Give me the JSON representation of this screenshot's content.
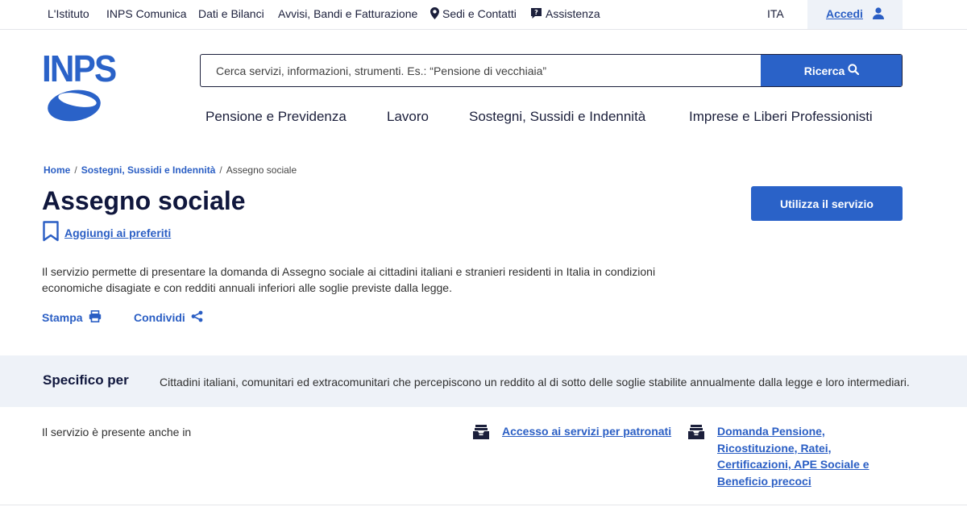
{
  "topbar": {
    "links": [
      {
        "label": "L'Istituto"
      },
      {
        "label": "INPS Comunica"
      },
      {
        "label": "Dati e Bilanci"
      },
      {
        "label": "Avvisi, Bandi e Fatturazione"
      },
      {
        "label": "Sedi e Contatti",
        "icon": "map-pin-icon"
      },
      {
        "label": "Assistenza",
        "icon": "chat-question-icon"
      }
    ],
    "language": "ITA",
    "login_label": "Accedi"
  },
  "logo": {
    "text": "INPS"
  },
  "search": {
    "placeholder": "Cerca servizi, informazioni, strumenti. Es.: “Pensione di vecchiaia”",
    "value": "",
    "button_label": "Ricerca"
  },
  "main_nav": [
    {
      "label": "Pensione e Previdenza"
    },
    {
      "label": "Lavoro"
    },
    {
      "label": "Sostegni, Sussidi e Indennità"
    },
    {
      "label": "Imprese e Liberi Professionisti"
    }
  ],
  "breadcrumb": {
    "items": [
      {
        "label": "Home"
      },
      {
        "label": "Sostegni, Sussidi e Indennità"
      }
    ],
    "separator": "/",
    "current": "Assegno sociale"
  },
  "page": {
    "title": "Assegno sociale",
    "favorite_label": "Aggiungi ai preferiti",
    "cta_label": "Utilizza il servizio",
    "description": "Il servizio permette di presentare la domanda di Assegno sociale ai cittadini italiani e stranieri residenti in Italia in condizioni economiche disagiate e con redditi annuali inferiori alle soglie previste dalla legge.",
    "print_label": "Stampa",
    "share_label": "Condividi"
  },
  "specific": {
    "label": "Specifico per",
    "value": "Cittadini italiani, comunitari ed extracomunitari che percepiscono un reddito al di sotto delle soglie stabilite annualmente dalla legge e loro intermediari."
  },
  "also_in": {
    "label": "Il servizio è presente anche in",
    "items": [
      {
        "label": "Accesso ai servizi per patronati",
        "icon": "inbox-tray-icon"
      },
      {
        "label": "Domanda Pensione, Ricostituzione, Ratei, Certificazioni, APE Sociale e Beneficio precoci",
        "icon": "inbox-tray-icon"
      }
    ]
  },
  "colors": {
    "accent": "#2a62c8",
    "link": "#2a5ec4",
    "title": "#10173d",
    "band": "#eef2f8"
  }
}
